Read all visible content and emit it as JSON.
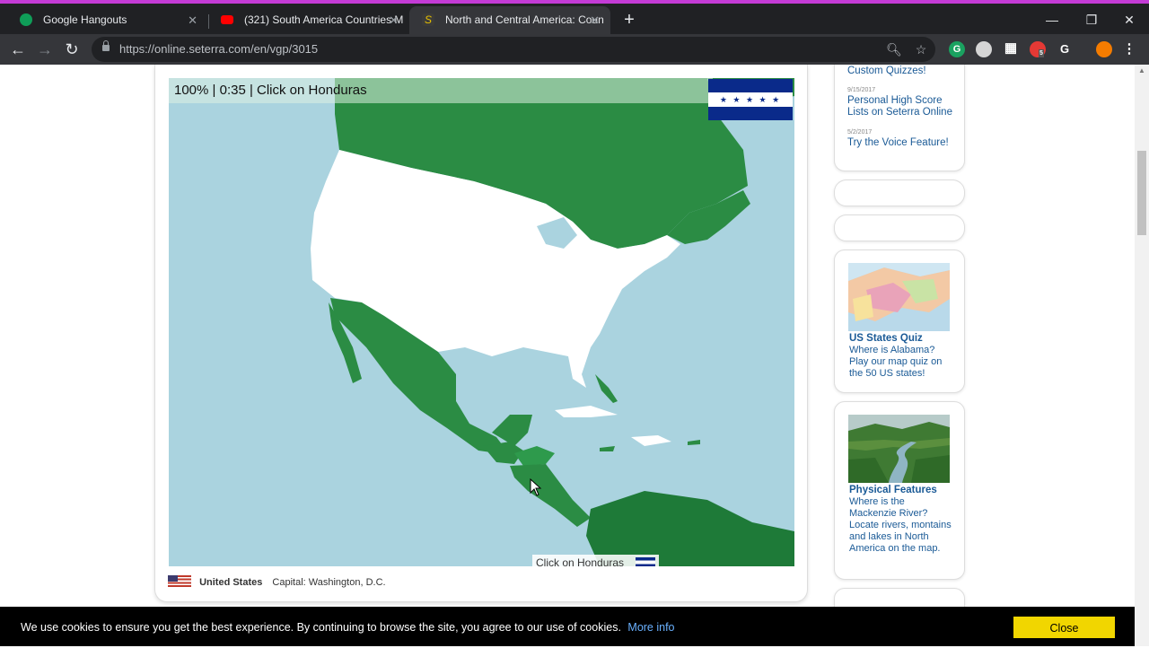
{
  "browser": {
    "tabs": [
      {
        "title": "Google Hangouts",
        "favicon": "hangouts-icon",
        "color": "#0f9d58",
        "active": false
      },
      {
        "title": "(321) South America Countries M",
        "favicon": "youtube-icon",
        "color": "#ff0000",
        "active": false
      },
      {
        "title": "North and Central America: Coun",
        "favicon": "seterra-icon",
        "color": "#e8c000",
        "active": true
      }
    ],
    "url": "https://online.seterra.com/en/vgp/3015",
    "extension_badge": "5",
    "extension_letter": "G"
  },
  "game": {
    "status": "100% | 0:35 | Click on Honduras",
    "tooltip": "Click on Honduras",
    "flag_stars": "★ ★ ★ ★ ★",
    "target_flag_colors": [
      "#0a2a8a",
      "#ffffff",
      "#0a2a8a"
    ],
    "hovered_country": {
      "name": "United States",
      "capital": "Capital: Washington, D.C."
    },
    "colors": {
      "ocean": "#aad3df",
      "land": "#2b8c44",
      "highlight": "#ffffff"
    }
  },
  "sidebar": {
    "news": [
      {
        "date": "",
        "title": "Custom Quizzes!"
      },
      {
        "date": "9/15/2017",
        "title": "Personal High Score Lists on Seterra Online"
      },
      {
        "date": "5/2/2017",
        "title": "Try the Voice Feature!"
      }
    ],
    "promos": [
      {
        "title": "US States Quiz",
        "text": "Where is Alabama? Play our map quiz on the 50 US states!"
      },
      {
        "title": "Physical Features",
        "text": "Where is the Mackenzie River? Locate rivers, montains and lakes in North America on the map."
      }
    ]
  },
  "cookie": {
    "text": "We use cookies to ensure you get the best experience. By continuing to browse the site, you agree to our use of cookies.",
    "more_info": "More info",
    "close_label": "Close"
  }
}
